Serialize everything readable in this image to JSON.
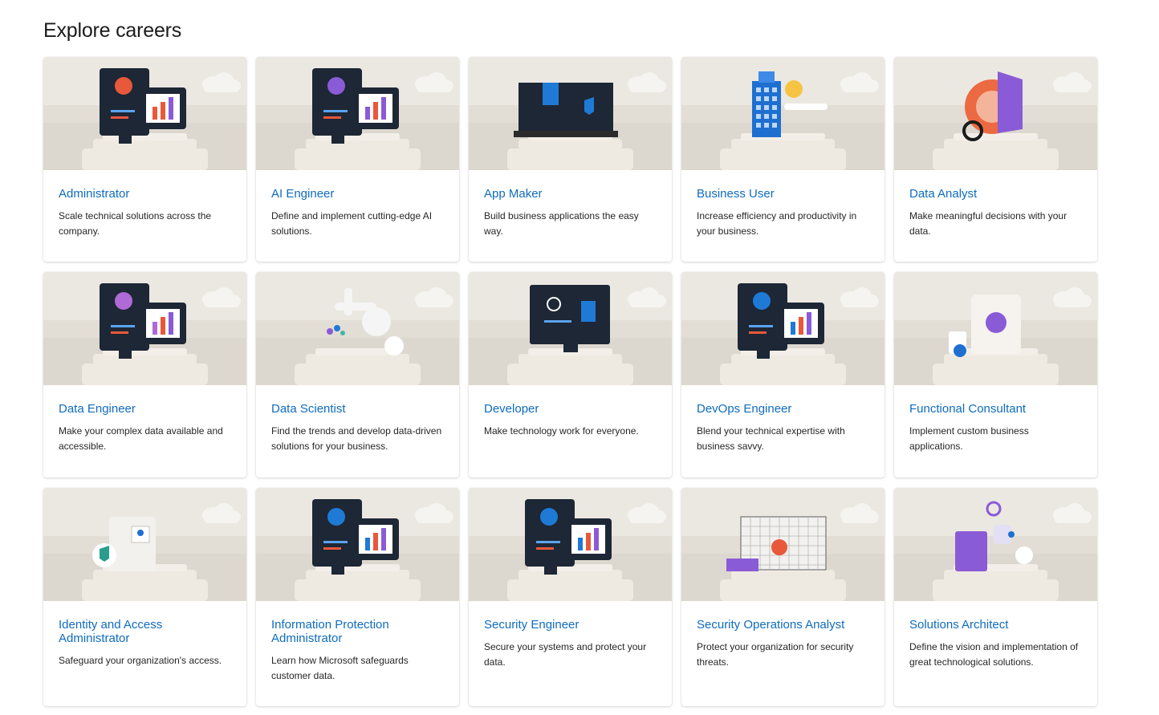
{
  "page": {
    "title": "Explore careers"
  },
  "careers": [
    {
      "title": "Administrator",
      "description": "Scale technical solutions across the company.",
      "illustration": "monitor-with-user-profile",
      "accent": "#e8583a"
    },
    {
      "title": "AI Engineer",
      "description": "Define and implement cutting-edge AI solutions.",
      "illustration": "terminal-and-brain",
      "accent": "#8a5bd6"
    },
    {
      "title": "App Maker",
      "description": "Build business applications the easy way.",
      "illustration": "laptop-app-builder",
      "accent": "#1f7ad6"
    },
    {
      "title": "Business User",
      "description": "Increase efficiency and productivity in your business.",
      "illustration": "office-building",
      "accent": "#1f6fd1"
    },
    {
      "title": "Data Analyst",
      "description": "Make meaningful decisions with your data.",
      "illustration": "pie-chart-magnifier",
      "accent": "#8a5bd6"
    },
    {
      "title": "Data Engineer",
      "description": "Make your complex data available and accessible.",
      "illustration": "terminal-and-laptop-chart",
      "accent": "#b06ad6"
    },
    {
      "title": "Data Scientist",
      "description": "Find the trends and develop data-driven solutions for your business.",
      "illustration": "microscope",
      "accent": "#1f7ad6"
    },
    {
      "title": "Developer",
      "description": "Make technology work for everyone.",
      "illustration": "monitor-code-globe",
      "accent": "#1f7ad6"
    },
    {
      "title": "DevOps Engineer",
      "description": "Blend your technical expertise with business savvy.",
      "illustration": "terminal-compass-pipeline",
      "accent": "#1f7ad6"
    },
    {
      "title": "Functional Consultant",
      "description": "Implement custom business applications.",
      "illustration": "clipboard-chat",
      "accent": "#8a5bd6"
    },
    {
      "title": "Identity and Access Administrator",
      "description": "Safeguard your organization's access.",
      "illustration": "door-shield-key",
      "accent": "#2a9d8f"
    },
    {
      "title": "Information Protection Administrator",
      "description": "Learn how Microsoft safeguards customer data.",
      "illustration": "terminal-safe-key",
      "accent": "#1f7ad6"
    },
    {
      "title": "Security Engineer",
      "description": "Secure your systems and protect your data.",
      "illustration": "shield-terminal-safe",
      "accent": "#1f7ad6"
    },
    {
      "title": "Security Operations Analyst",
      "description": "Protect your organization for security threats.",
      "illustration": "grid-screen-threats",
      "accent": "#8a5bd6"
    },
    {
      "title": "Solutions Architect",
      "description": "Define the vision and implementation of great technological solutions.",
      "illustration": "architecture-blocks",
      "accent": "#8a5bd6"
    }
  ]
}
